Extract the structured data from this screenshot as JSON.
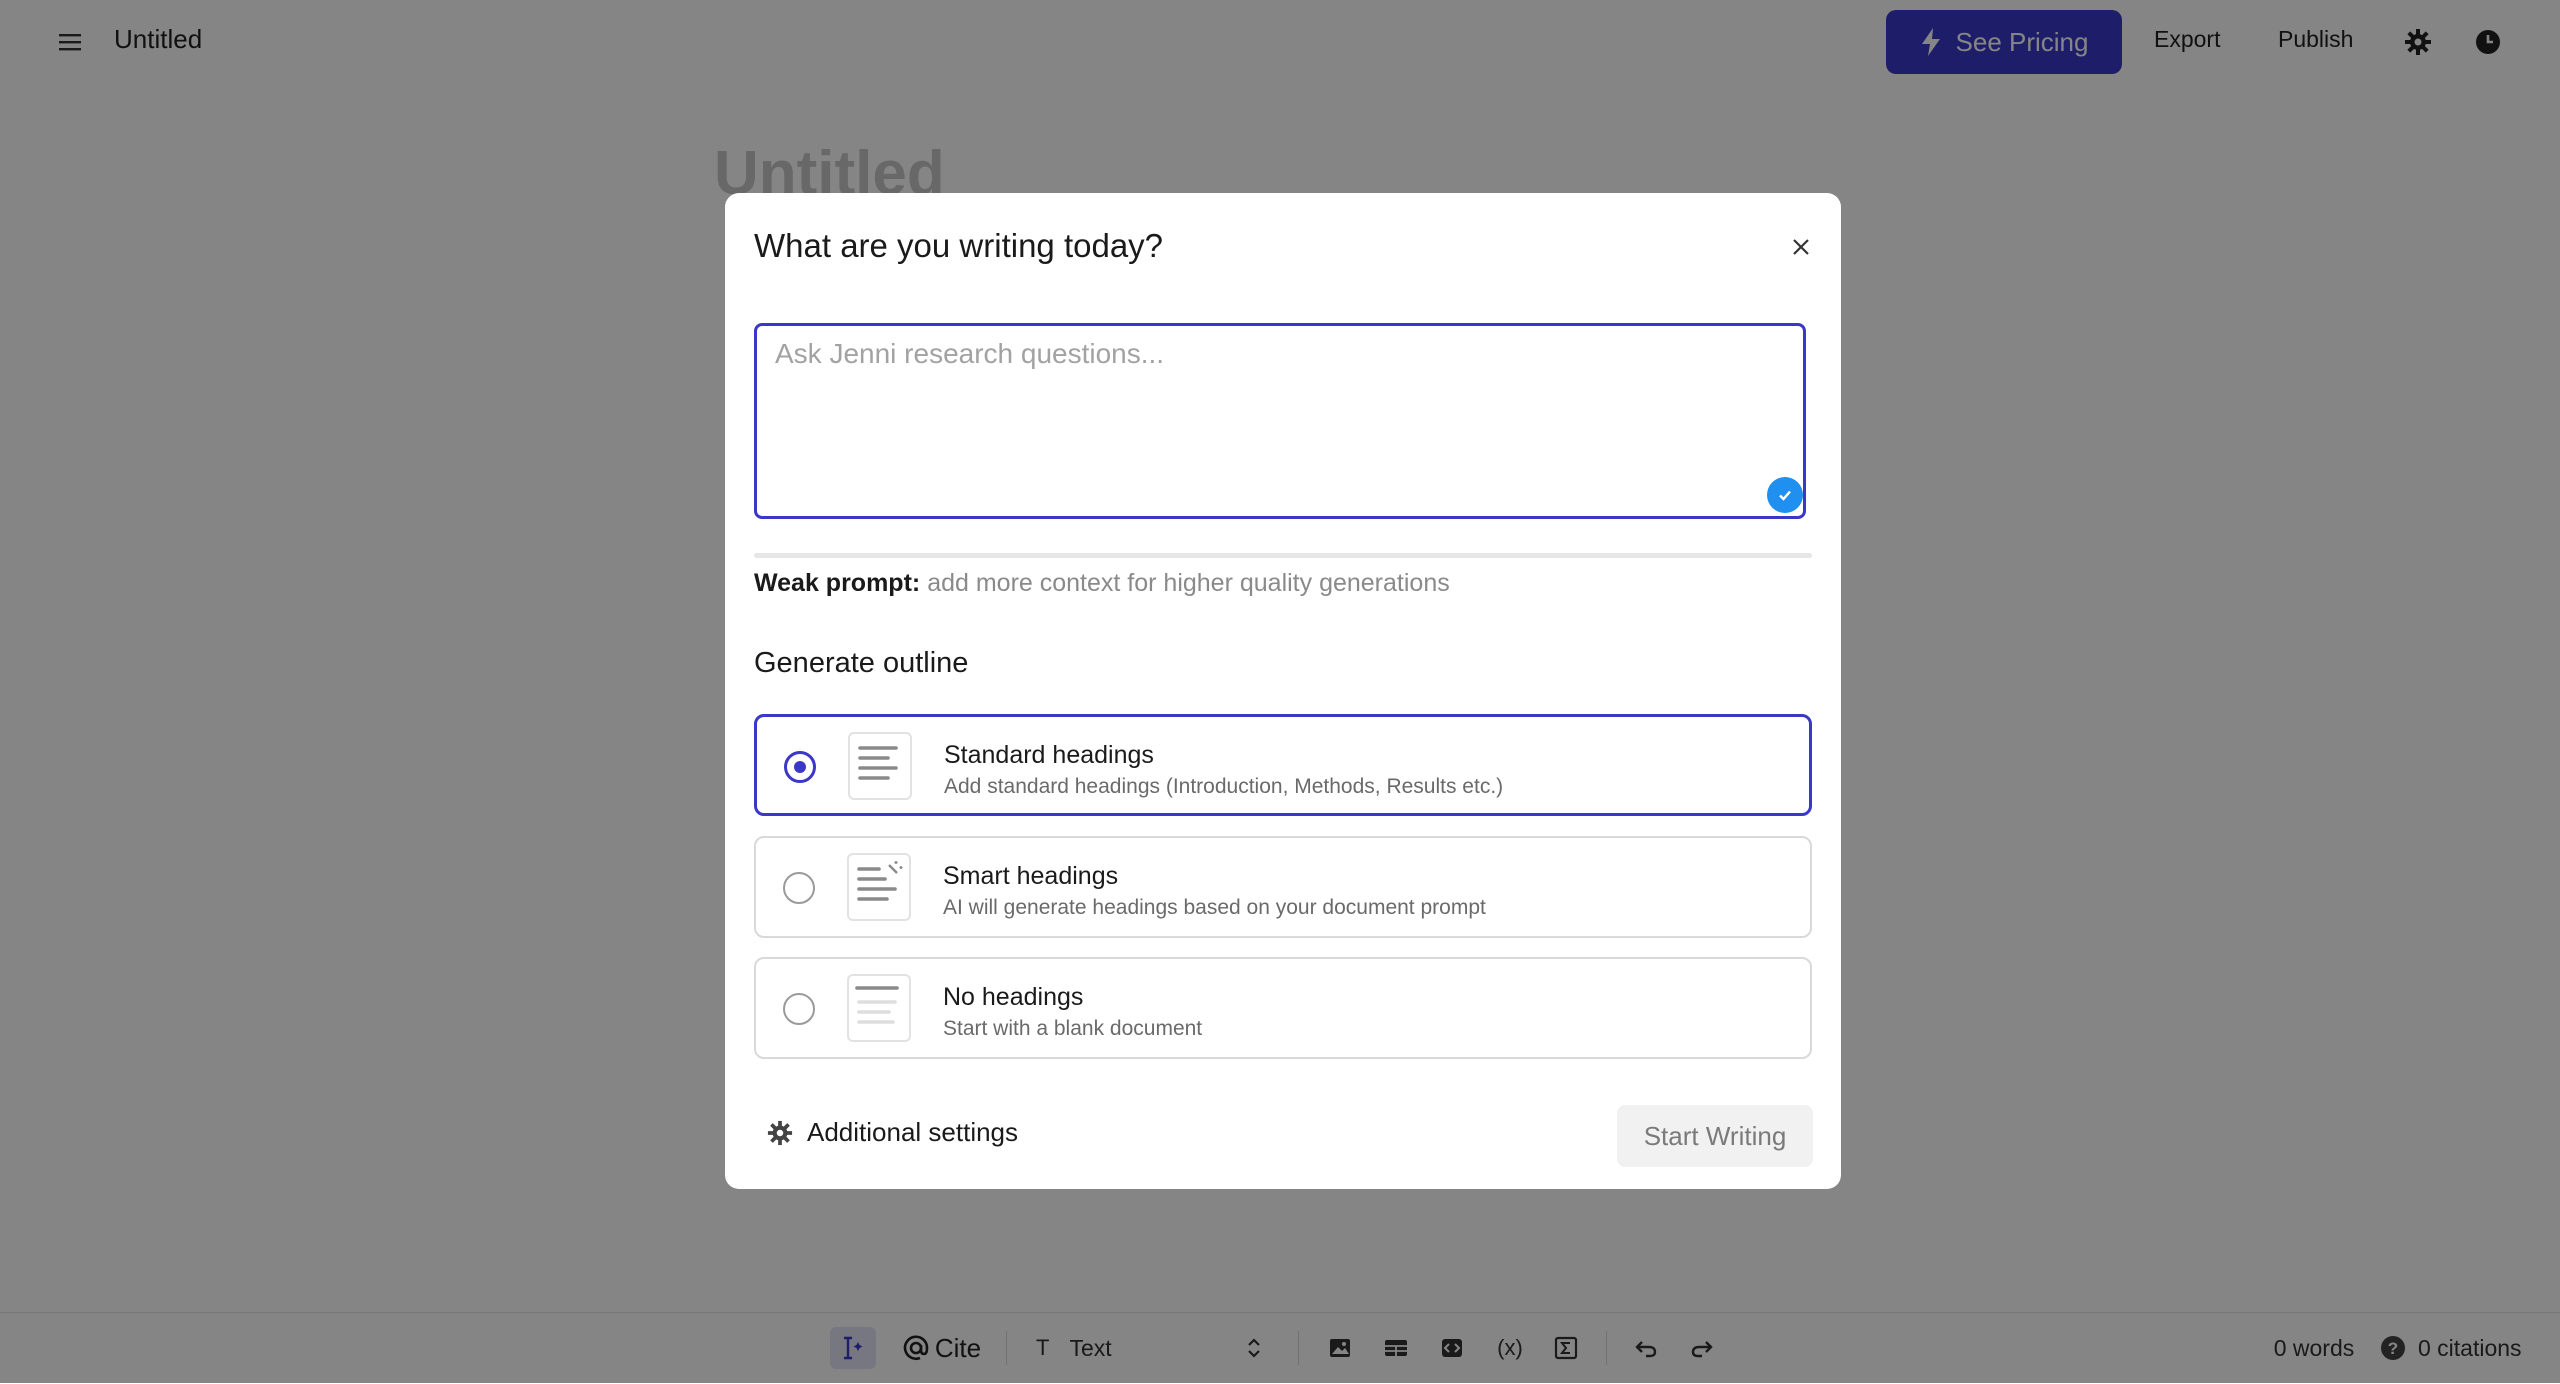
{
  "topbar": {
    "doc_title": "Untitled",
    "pricing_label": "See Pricing",
    "export_label": "Export",
    "publish_label": "Publish"
  },
  "editor": {
    "heading": "Untitled"
  },
  "bottombar": {
    "cite_label": "Cite",
    "text_style_label": "Text",
    "word_count": "0 words",
    "citation_count": "0 citations"
  },
  "modal": {
    "title": "What are you writing today?",
    "prompt_placeholder": "Ask Jenni research questions...",
    "prompt_value": "",
    "weak_label": "Weak prompt:",
    "weak_hint": "add more context for higher quality generations",
    "section_title": "Generate outline",
    "options": [
      {
        "title": "Standard headings",
        "desc": "Add standard headings (Introduction, Methods, Results etc.)",
        "selected": true
      },
      {
        "title": "Smart headings",
        "desc": "AI will generate headings based on your document prompt",
        "selected": false
      },
      {
        "title": "No headings",
        "desc": "Start with a blank document",
        "selected": false
      }
    ],
    "settings_label": "Additional settings",
    "start_label": "Start Writing"
  },
  "colors": {
    "accent": "#3b38c9",
    "check": "#1f8ff0",
    "overlay": "rgba(0,0,0,0.48)"
  },
  "icons": [
    "menu-icon",
    "bolt-icon",
    "gear-icon",
    "clock-icon",
    "close-icon",
    "check-icon",
    "cursor-ai-icon",
    "at-icon",
    "text-type-icon",
    "chevron-updown-icon",
    "image-icon",
    "table-icon",
    "code-icon",
    "variable-icon",
    "sigma-icon",
    "undo-icon",
    "redo-icon",
    "help-icon"
  ]
}
